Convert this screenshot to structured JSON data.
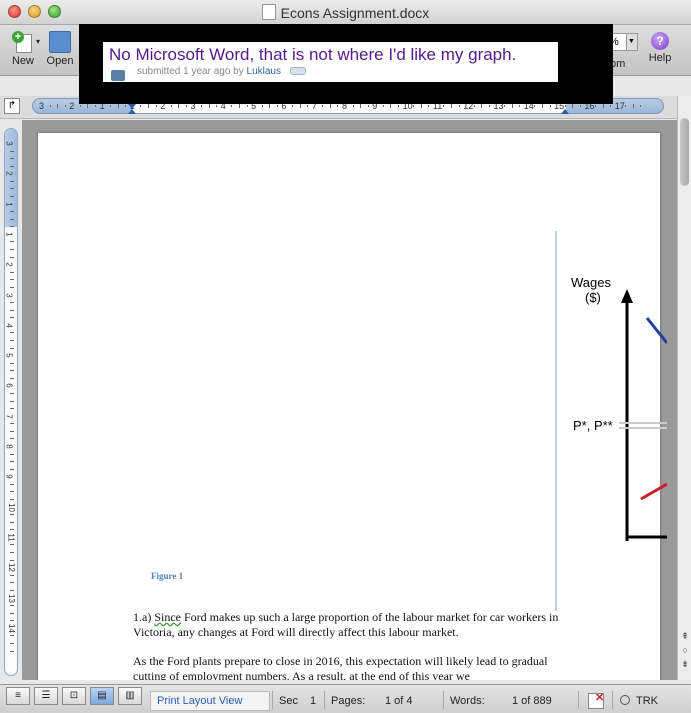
{
  "window": {
    "title": "Econs Assignment.docx"
  },
  "toolbar": {
    "new_label": "New",
    "open_label": "Open",
    "zoom_label": "om",
    "zoom_value": "%",
    "help_label": "Help"
  },
  "overlay_post": {
    "title": "No Microsoft Word, that is not where I'd like my graph.",
    "submitted": "submitted 1 year ago by",
    "author": "Luklaus"
  },
  "ruler": {
    "numbers": [
      "3",
      "2",
      "1",
      "1",
      "2",
      "3",
      "4",
      "5",
      "6",
      "7",
      "8",
      "9",
      "10",
      "11",
      "12",
      "13",
      "14",
      "15",
      "16",
      "17"
    ]
  },
  "vruler": {
    "numbers": [
      "3",
      "2",
      "1",
      "1",
      "2",
      "3",
      "4",
      "5",
      "6",
      "7",
      "8",
      "9",
      "10",
      "11",
      "12",
      "13",
      "14"
    ]
  },
  "document": {
    "figure_caption": "Figure 1",
    "paragraph1": "1.a) Since Ford makes up such a large proportion of the labour market for car workers in Victoria, any changes at Ford will directly affect this labour market.",
    "paragraph2": "As the Ford plants prepare to close in 2016, this expectation will likely lead to gradual cutting of employment numbers. As a result, at the end of this year we"
  },
  "graph": {
    "y_label_line1": "Wages",
    "y_label_line2": "($)",
    "price_label": "P*, P**",
    "colors": {
      "line_blue": "#1f3fa8",
      "line_red": "#c8202a"
    }
  },
  "status": {
    "view": "Print Layout View",
    "sec_label": "Sec",
    "sec_value": "1",
    "pages_label": "Pages:",
    "pages_value": "1 of 4",
    "words_label": "Words:",
    "words_value": "1 of 889",
    "trk": "TRK"
  }
}
